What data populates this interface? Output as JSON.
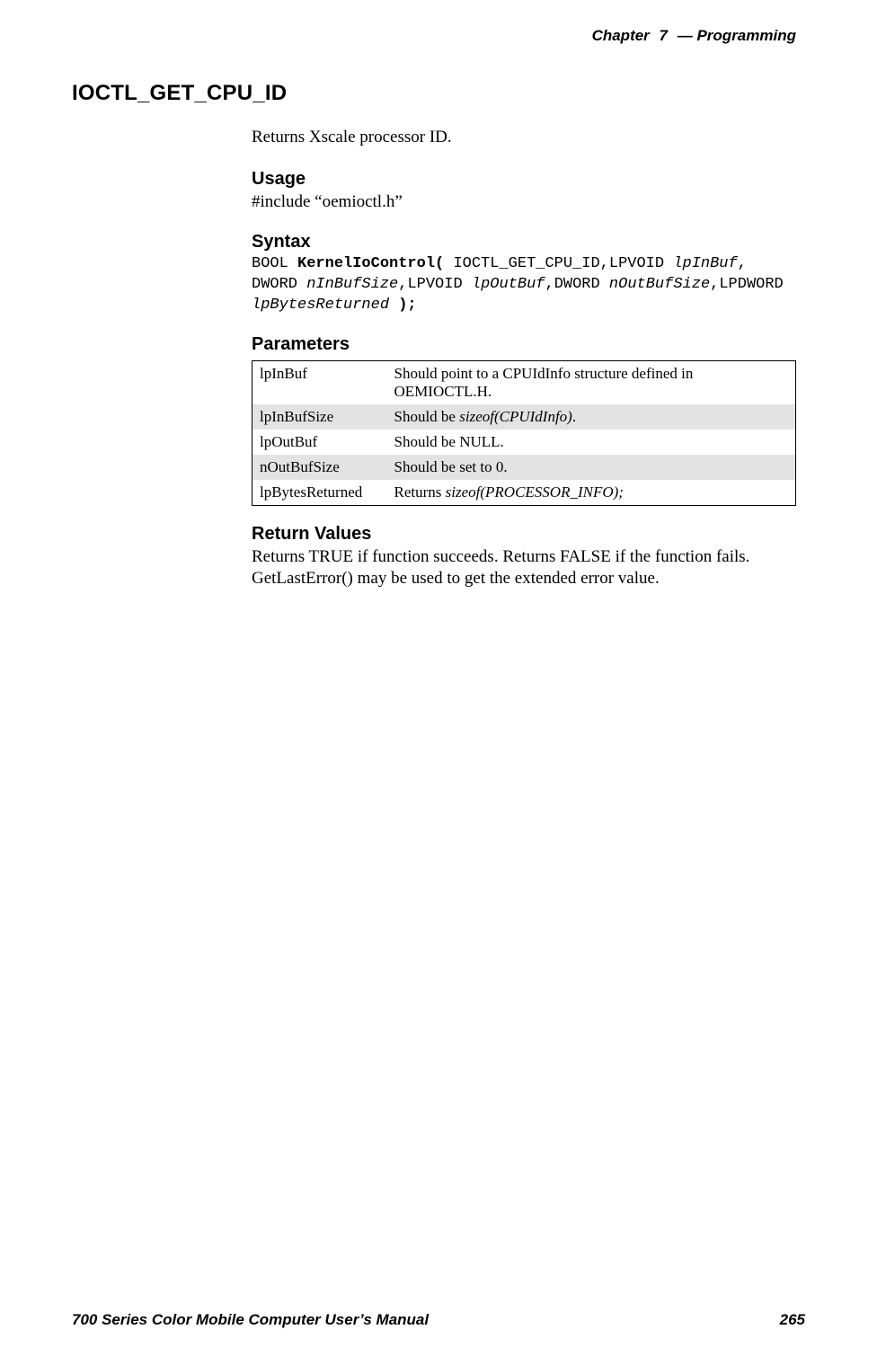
{
  "header": {
    "chapter_word": "Chapter",
    "chapter_num": "7",
    "dash": "—",
    "title": "Programming"
  },
  "section": {
    "title": "IOCTL_GET_CPU_ID",
    "intro": "Returns Xscale processor ID."
  },
  "usage": {
    "heading": "Usage",
    "text": "#include “oemioctl.h”"
  },
  "syntax": {
    "heading": "Syntax",
    "t01": "BOOL ",
    "t02": "KernelIoControl(",
    "t03": " IOCTL_GET_CPU_ID,LPVOID ",
    "t04": "lpInBuf",
    "t05": ",",
    "t06": "DWORD ",
    "t07": "nInBufSize",
    "t08": ",LPVOID ",
    "t09": "lpOutBuf",
    "t10": ",DWORD ",
    "t11": "nOutBufSize",
    "t12": ",LPDWORD",
    "t13": "lpBytesReturned",
    "t14": " );"
  },
  "parameters": {
    "heading": "Parameters",
    "rows": [
      {
        "name": "lpInBuf",
        "desc_pre": "Should point to a CPUIdInfo structure defined in OEMIOCTL.H.",
        "desc_ital": "",
        "desc_post": ""
      },
      {
        "name": "lpInBufSize",
        "desc_pre": "Should be ",
        "desc_ital": "sizeof(CPUIdInfo)",
        "desc_post": "."
      },
      {
        "name": "lpOutBuf",
        "desc_pre": "Should be NULL.",
        "desc_ital": "",
        "desc_post": ""
      },
      {
        "name": "nOutBufSize",
        "desc_pre": "Should be set to 0.",
        "desc_ital": "",
        "desc_post": ""
      },
      {
        "name": "lpBytesReturned",
        "desc_pre": "Returns ",
        "desc_ital": "sizeof(PROCESSOR_INFO);",
        "desc_post": ""
      }
    ]
  },
  "return_values": {
    "heading": "Return Values",
    "text": "Returns TRUE if function succeeds. Returns FALSE if the function fails. GetLastError() may be used to get the extended error value."
  },
  "footer": {
    "left": "700 Series Color Mobile Computer User’s Manual",
    "right": "265"
  }
}
